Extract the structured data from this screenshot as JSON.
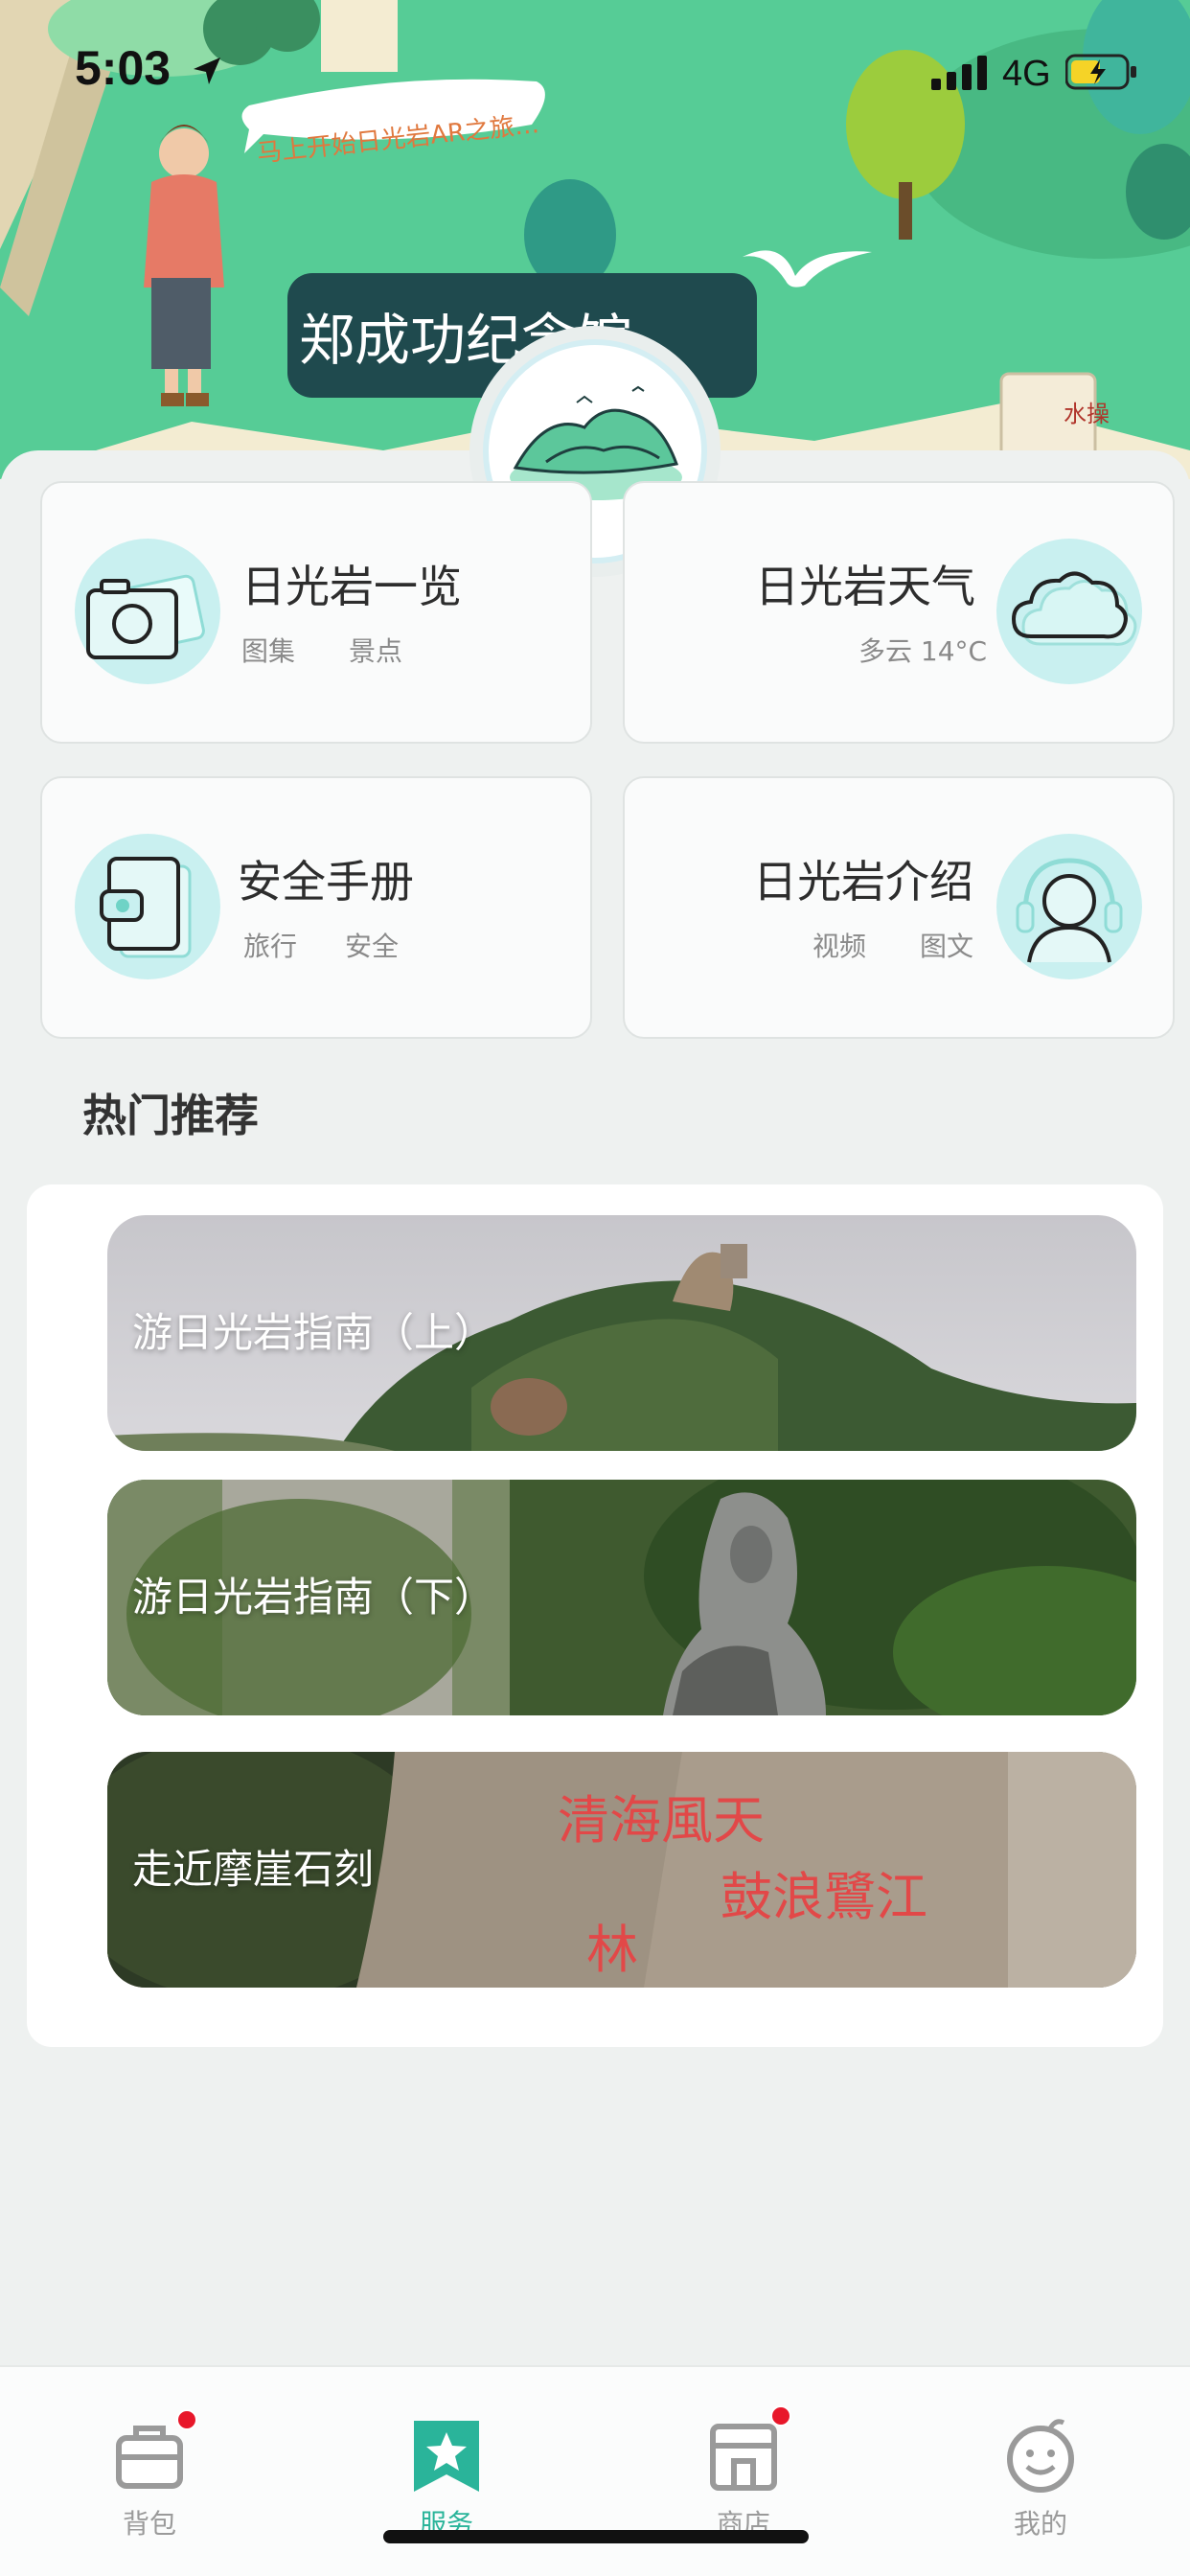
{
  "status_bar": {
    "time": "5:03",
    "network": "4G"
  },
  "hero": {
    "speech_bubble": "马上开始日光岩AR之旅…",
    "banner_text": "郑成功纪念馆",
    "sign_text": "水操"
  },
  "features": [
    {
      "title": "日光岩一览",
      "tags": [
        "图集",
        "景点"
      ],
      "icon": "camera-icon"
    },
    {
      "title": "日光岩天气",
      "tags": [
        "多云 14°C"
      ],
      "icon": "cloud-icon"
    },
    {
      "title": "安全手册",
      "tags": [
        "旅行",
        "安全"
      ],
      "icon": "wallet-icon"
    },
    {
      "title": "日光岩介绍",
      "tags": [
        "视频",
        "图文"
      ],
      "icon": "headset-icon"
    }
  ],
  "section": {
    "title": "热门推荐"
  },
  "recommendations": [
    {
      "title": "游日光岩指南（上）"
    },
    {
      "title": "游日光岩指南（下）"
    },
    {
      "title": "走近摩崖石刻"
    }
  ],
  "inscription": {
    "line1": "清海風天",
    "line2": "鼓浪鷺江",
    "line3": "林"
  },
  "tabs": [
    {
      "label": "背包",
      "icon": "backpack-icon",
      "badge": true,
      "active": false
    },
    {
      "label": "服务",
      "icon": "star-bookmark-icon",
      "badge": false,
      "active": true
    },
    {
      "label": "商店",
      "icon": "shop-icon",
      "badge": true,
      "active": false
    },
    {
      "label": "我的",
      "icon": "smiley-icon",
      "badge": false,
      "active": false
    }
  ],
  "colors": {
    "accent": "#2ab49a",
    "hero_green": "#55cc95",
    "icon_bg": "#c9f0f0",
    "badge": "#e8172a"
  }
}
